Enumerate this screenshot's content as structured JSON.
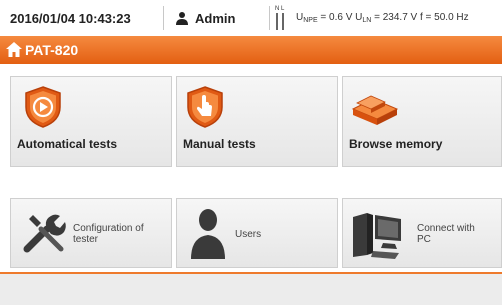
{
  "status": {
    "datetime": "2016/01/04 10:43:23",
    "user": "Admin",
    "phase_top": "N L",
    "measurement_parts": [
      {
        "t": "U"
      },
      {
        "t": "NPE",
        "sub": true
      },
      {
        "t": " = 0.6 V U"
      },
      {
        "t": "LN",
        "sub": true
      },
      {
        "t": " = 234.7 V f = 50.0 Hz"
      }
    ]
  },
  "title": {
    "text": "PAT-820",
    "home_icon": "home-icon"
  },
  "tiles": [
    {
      "id": "automatical-tests",
      "label": "Automatical tests",
      "icon": "automatical-tests-icon"
    },
    {
      "id": "manual-tests",
      "label": "Manual tests",
      "icon": "manual-tests-icon"
    },
    {
      "id": "browse-memory",
      "label": "Browse memory",
      "icon": "browse-memory-icon"
    },
    {
      "id": "configuration",
      "label_line1": "Configuration of",
      "label_line2": "tester",
      "icon": "tools-icon"
    },
    {
      "id": "users",
      "label": "Users",
      "icon": "user-silhouette-icon"
    },
    {
      "id": "connect-pc",
      "label_line1": "Connect with",
      "label_line2": "PC",
      "icon": "computer-icon"
    }
  ],
  "colors": {
    "accent": "#ee7a2c",
    "title_bar_top": "#f58a3f",
    "title_bar_bottom": "#e35f12"
  }
}
